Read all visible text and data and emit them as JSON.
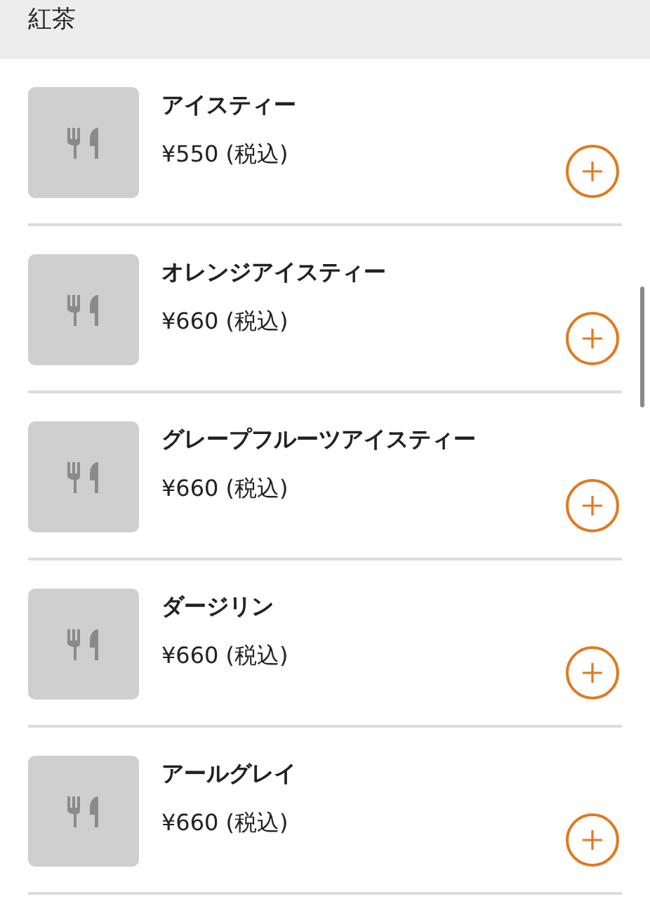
{
  "header": {
    "title": "紅茶"
  },
  "items": [
    {
      "name": "アイスティー",
      "price": "¥550 (税込)"
    },
    {
      "name": "オレンジアイスティー",
      "price": "¥660 (税込)"
    },
    {
      "name": "グレープフルーツアイスティー",
      "price": "¥660 (税込)"
    },
    {
      "name": "ダージリン",
      "price": "¥660 (税込)"
    },
    {
      "name": "アールグレイ",
      "price": "¥660 (税込)"
    }
  ]
}
